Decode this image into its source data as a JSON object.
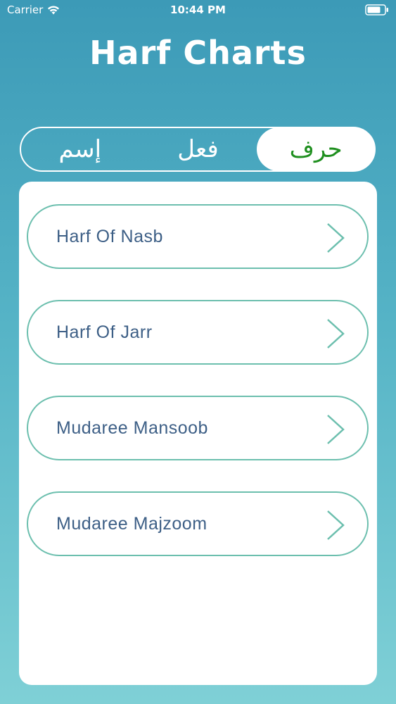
{
  "status_bar": {
    "carrier": "Carrier",
    "time": "10:44 PM"
  },
  "header": {
    "title": "Harf Charts"
  },
  "segments": [
    {
      "label": "إسم",
      "selected": false
    },
    {
      "label": "فعل",
      "selected": false
    },
    {
      "label": "حرف",
      "selected": true
    }
  ],
  "list": {
    "items": [
      {
        "label": "Harf Of Nasb"
      },
      {
        "label": "Harf Of Jarr"
      },
      {
        "label": "Mudaree Mansoob"
      },
      {
        "label": "Mudaree Majzoom"
      }
    ]
  },
  "colors": {
    "accent_green": "#1f8f1f",
    "item_border": "#6cbfae",
    "item_text": "#3d5f86"
  }
}
